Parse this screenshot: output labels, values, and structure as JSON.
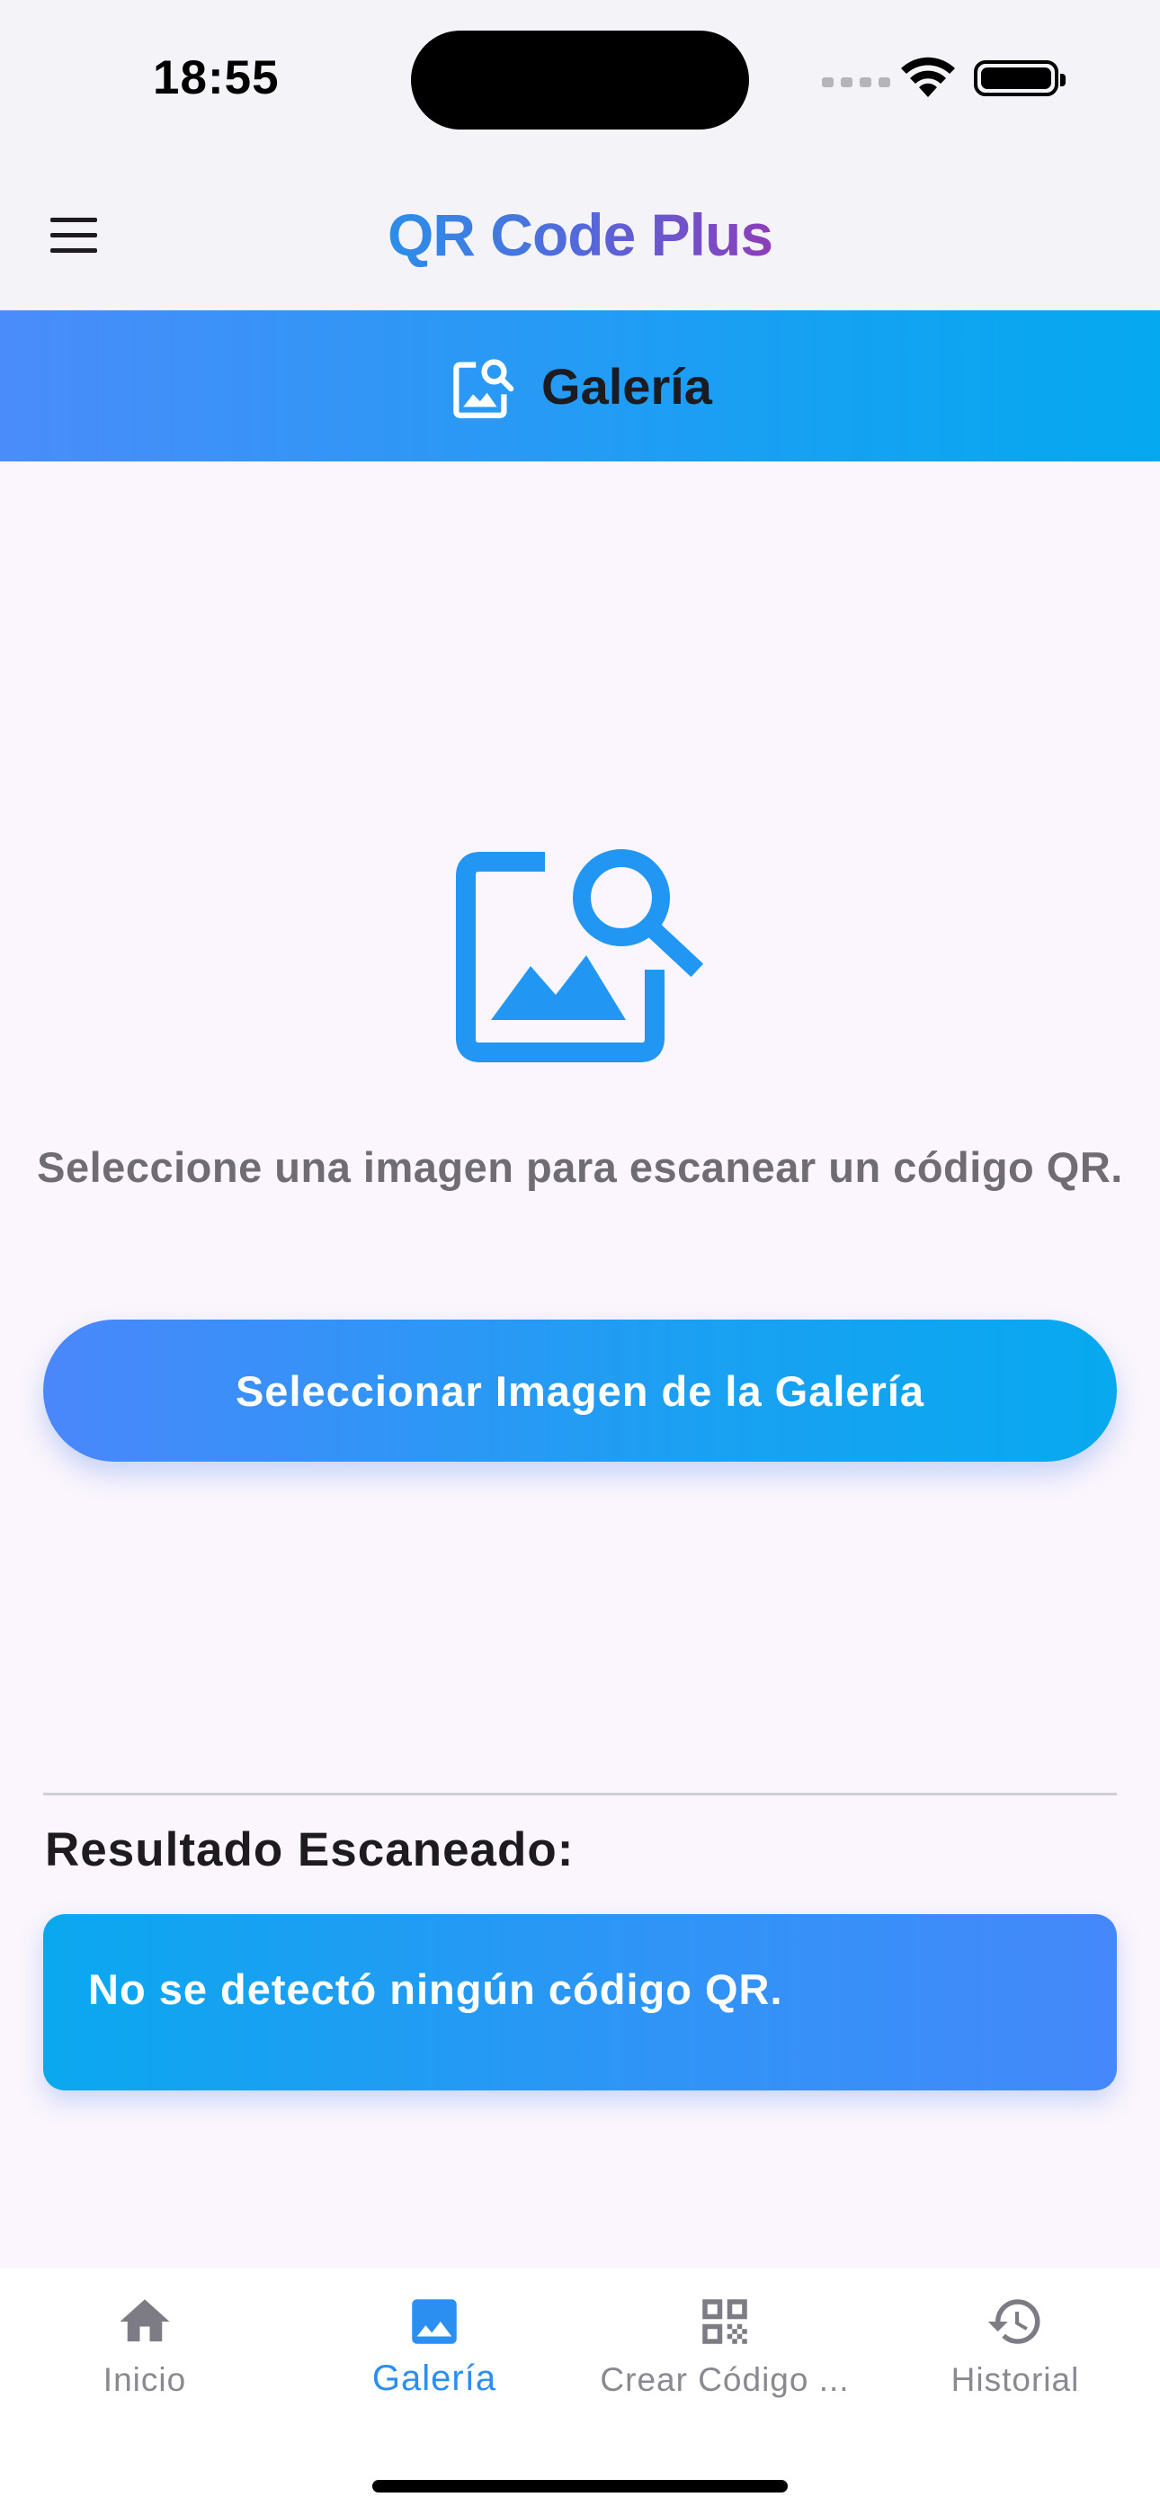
{
  "status_bar": {
    "time": "18:55"
  },
  "app_bar": {
    "title": "QR Code Plus",
    "menu_icon": "hamburger-menu-icon"
  },
  "banner": {
    "title": "Galería",
    "icon": "image-search-icon"
  },
  "main": {
    "icon": "image-search-icon",
    "instruction": "Seleccione una imagen para escanear un código QR.",
    "select_button_label": "Seleccionar Imagen de la Galería",
    "result_heading": "Resultado Escaneado:",
    "result_text": "No se detectó ningún código QR."
  },
  "bottom_nav": {
    "items": [
      {
        "label": "Inicio",
        "icon": "home-icon",
        "active": false
      },
      {
        "label": "Galería",
        "icon": "image-icon",
        "active": true
      },
      {
        "label": "Crear Código ...",
        "icon": "qr-code-icon",
        "active": false
      },
      {
        "label": "Historial",
        "icon": "history-icon",
        "active": false
      }
    ]
  },
  "colors": {
    "accent_blue": "#2a8ff0",
    "gradient_start": "#4a8cfa",
    "gradient_end": "#05a9ef",
    "title_purple": "#8e3db9",
    "background": "#fbf6fd"
  }
}
